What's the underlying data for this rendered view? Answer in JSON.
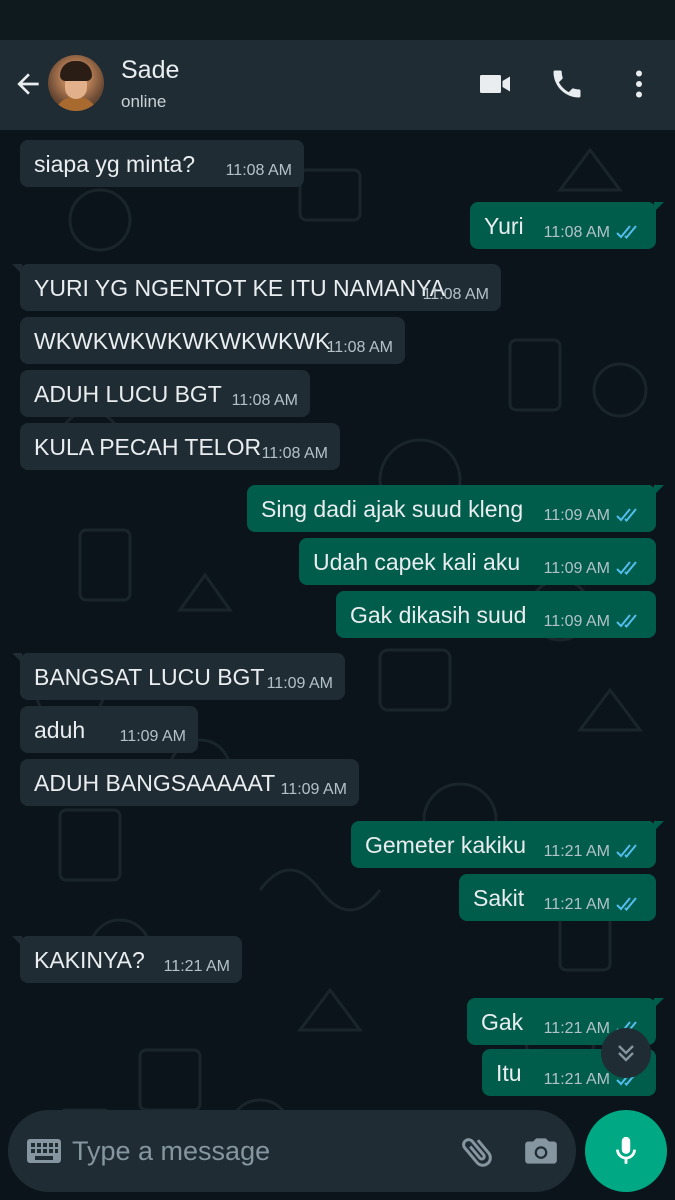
{
  "header": {
    "contact_name": "Sade",
    "contact_status": "online",
    "icons": [
      "back-arrow-icon",
      "video-call-icon",
      "voice-call-icon",
      "more-options-icon"
    ]
  },
  "messages": [
    {
      "dir": "in",
      "text": "siapa yg minta?",
      "time": "11:08 AM"
    },
    {
      "dir": "out",
      "text": "Yuri",
      "time": "11:08 AM",
      "status": "read"
    },
    {
      "dir": "in",
      "text": "YURI YG NGENTOT KE ITU NAMANYA",
      "time": "11:08 AM"
    },
    {
      "dir": "in",
      "text": "WKWKWKWKWKWKWKWK",
      "time": "11:08 AM"
    },
    {
      "dir": "in",
      "text": "ADUH LUCU BGT",
      "time": "11:08 AM"
    },
    {
      "dir": "in",
      "text": "KULA PECAH TELOR",
      "time": "11:08 AM"
    },
    {
      "dir": "out",
      "text": "Sing dadi ajak suud kleng",
      "time": "11:09 AM",
      "status": "read"
    },
    {
      "dir": "out",
      "text": "Udah capek kali aku",
      "time": "11:09 AM",
      "status": "read"
    },
    {
      "dir": "out",
      "text": "Gak dikasih suud",
      "time": "11:09 AM",
      "status": "read"
    },
    {
      "dir": "in",
      "text": "BANGSAT LUCU BGT",
      "time": "11:09 AM"
    },
    {
      "dir": "in",
      "text": "aduh",
      "time": "11:09 AM"
    },
    {
      "dir": "in",
      "text": "ADUH BANGSAAAAAT",
      "time": "11:09 AM"
    },
    {
      "dir": "out",
      "text": "Gemeter kakiku",
      "time": "11:21 AM",
      "status": "read"
    },
    {
      "dir": "out",
      "text": "Sakit",
      "time": "11:21 AM",
      "status": "read"
    },
    {
      "dir": "in",
      "text": "KAKINYA?",
      "time": "11:21 AM"
    },
    {
      "dir": "out",
      "text": "Gak",
      "time": "11:21 AM",
      "status": "read"
    },
    {
      "dir": "out",
      "text": "Itu",
      "time": "11:21 AM",
      "status": "read"
    }
  ],
  "composer": {
    "placeholder": "Type a message",
    "icons": [
      "keyboard-icon",
      "attach-icon",
      "camera-icon",
      "mic-icon"
    ]
  },
  "colors": {
    "header_bg": "#1f2c33",
    "chat_bg": "#0b141a",
    "incoming_bubble": "#1f2c33",
    "outgoing_bubble": "#005c4b",
    "read_tick": "#53bdeb",
    "accent": "#00a884"
  }
}
